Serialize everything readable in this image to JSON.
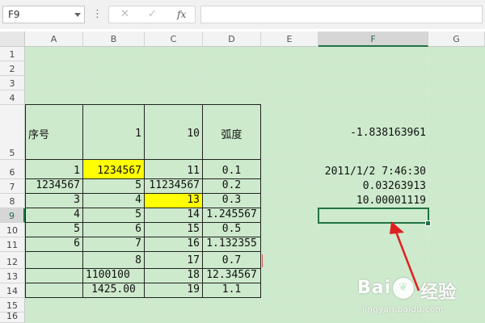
{
  "formula_bar": {
    "name_box": "F9",
    "options_glyph": "⋮",
    "cancel_icon": "✕",
    "enter_icon": "✓",
    "function_icon": "fx",
    "formula": ""
  },
  "columns": [
    "A",
    "B",
    "C",
    "D",
    "E",
    "F",
    "G"
  ],
  "rows": [
    "1",
    "2",
    "3",
    "4",
    "5",
    "6",
    "7",
    "8",
    "9",
    "10",
    "11",
    "12",
    "13",
    "14",
    "15",
    "16"
  ],
  "selected": {
    "cell": "F9",
    "column": "F",
    "row": "9"
  },
  "cells": {
    "A5": "序号",
    "B5": "1",
    "C5": "10",
    "D5": "弧度",
    "F5": "-1.838163961",
    "A6": "1",
    "B6": "1234567",
    "C6": "11",
    "D6": "0.1",
    "F6": "2011/1/2 7:46:30",
    "A7": "1234567",
    "B7": "5",
    "C7": "11234567",
    "D7": "0.2",
    "F7": "0.03263913",
    "A8": "3",
    "B8": "4",
    "C8": "13",
    "D8": "0.3",
    "F8": "10.00001119",
    "A9": "4",
    "B9": "5",
    "C9": "14",
    "D9": "1.245567",
    "A10": "5",
    "B10": "6",
    "C10": "15",
    "D10": "0.5",
    "A11": "6",
    "B11": "7",
    "C11": "16",
    "D11": "1.132355",
    "A12": "",
    "B12": "8",
    "C12": "17",
    "D12": "0.7",
    "A13": "",
    "B13": "1100100",
    "C13": "18",
    "D13": "12.34567",
    "A14": "",
    "B14": "1425.00",
    "C14": "19",
    "D14": "1.1"
  },
  "colors": {
    "cell_background": "#cdeacc",
    "highlight_yellow": "#ffff00",
    "selection_green": "#217346",
    "arrow_red": "#e02020"
  },
  "watermark": {
    "logo_left": "Bai",
    "logo_right": "经验",
    "url": "jingyan.baidu.com"
  }
}
